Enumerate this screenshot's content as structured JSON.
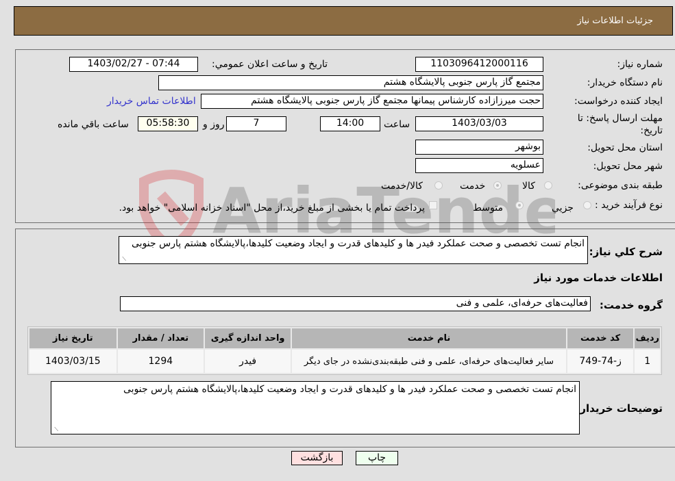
{
  "header": {
    "title": "جزئیات اطلاعات نیاز"
  },
  "form": {
    "need_number": {
      "label": "شماره نیاز:",
      "value": "1103096412000116"
    },
    "announce_datetime": {
      "label": "تاریخ و ساعت اعلان عمومي:",
      "value": "1403/02/27 - 07:44"
    },
    "buyer_org": {
      "label": "نام دستگاه خریدار:",
      "value": "مجتمع گاز پارس جنوبی  پالایشگاه هشتم"
    },
    "requester": {
      "label": "ایجاد کننده درخواست:",
      "value": "حجت میرزازاده کارشناس پیمانها مجتمع گاز پارس جنوبی  پالایشگاه هشتم"
    },
    "contact_link": "اطلاعات تماس خریدار",
    "deadline": {
      "label": "مهلت ارسال پاسخ: تا تاریخ:",
      "date": "1403/03/03",
      "time_label": "ساعت",
      "time": "14:00",
      "days": "7",
      "days_label": "روز و",
      "remaining": "05:58:30",
      "remaining_label": "ساعت باقي مانده"
    },
    "province": {
      "label": "استان محل تحویل:",
      "value": "بوشهر"
    },
    "city": {
      "label": "شهر محل تحویل:",
      "value": "عسلویه"
    },
    "category": {
      "label": "طبقه بندی موضوعی:",
      "options": [
        {
          "label": "کالا",
          "selected": false
        },
        {
          "label": "خدمت",
          "selected": true
        },
        {
          "label": "کالا/خدمت",
          "selected": false
        }
      ]
    },
    "process_type": {
      "label": "نوع فرآیند خرید :",
      "options": [
        {
          "label": "جزيي",
          "selected": false
        },
        {
          "label": "متوسط",
          "selected": true
        }
      ],
      "checkbox_label": "پرداخت تمام یا بخشی از مبلغ خرید،از محل \"اسناد خزانه اسلامی\" خواهد بود.",
      "checkbox_checked": false
    }
  },
  "details": {
    "description_label": "شرح كلي نیاز:",
    "description": "انجام تست تخصصی و صحت عملکرد فیدر ها و کلیدهای قدرت و ایجاد وضعیت کلیدها،پالایشگاه هشتم پارس جنوبی",
    "services_title": "اطلاعات خدمات مورد نیاز",
    "service_group_label": "گروه خدمت:",
    "service_group": "فعالیت‌های حرفه‌ای، علمی و فنی",
    "table": {
      "headers": [
        "ردیف",
        "کد خدمت",
        "نام خدمت",
        "واحد اندازه گیری",
        "تعداد / مقدار",
        "تاریخ نیاز"
      ],
      "rows": [
        [
          "1",
          "ز-74-749",
          "سایر فعالیت‌های حرفه‌ای، علمی و فنی طبقه‌بندی‌نشده در جای دیگر",
          "فیدر",
          "1294",
          "1403/03/15"
        ]
      ]
    },
    "buyer_notes_label": "توضیحات خریدار:",
    "buyer_notes": "انجام تست تخصصی و صحت عملکرد فیدر ها و کلیدهای قدرت و ایجاد وضعیت کلیدها،پالایشگاه هشتم پارس جنوبی"
  },
  "buttons": {
    "print": "چاپ",
    "back": "بازگشت"
  },
  "watermark": {
    "text": "AriaTender.neT"
  },
  "colors": {
    "header_bg": "#8c6c42",
    "page_bg": "#e1e1e1",
    "print_bg": "#eeffee",
    "back_bg": "#ffe0e0",
    "link": "#3333cc"
  }
}
